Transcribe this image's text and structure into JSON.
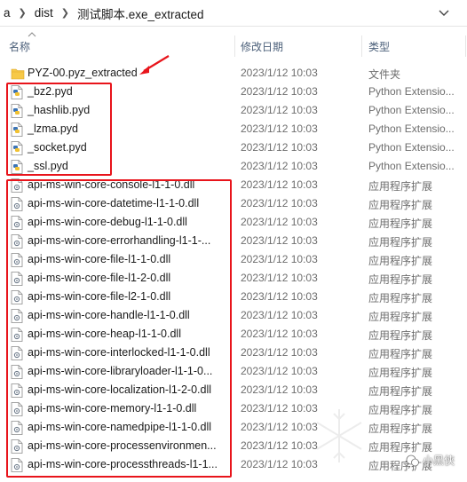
{
  "address": {
    "crumbs": [
      "a",
      "dist",
      "测试脚本.exe_extracted"
    ]
  },
  "columns": {
    "name": "名称",
    "date": "修改日期",
    "type": "类型"
  },
  "files": [
    {
      "name": "PYZ-00.pyz_extracted",
      "date": "2023/1/12 10:03",
      "type": "文件夹",
      "icon": "folder-icon"
    },
    {
      "name": "_bz2.pyd",
      "date": "2023/1/12 10:03",
      "type": "Python Extensio...",
      "icon": "python-file-icon"
    },
    {
      "name": "_hashlib.pyd",
      "date": "2023/1/12 10:03",
      "type": "Python Extensio...",
      "icon": "python-file-icon"
    },
    {
      "name": "_lzma.pyd",
      "date": "2023/1/12 10:03",
      "type": "Python Extensio...",
      "icon": "python-file-icon"
    },
    {
      "name": "_socket.pyd",
      "date": "2023/1/12 10:03",
      "type": "Python Extensio...",
      "icon": "python-file-icon"
    },
    {
      "name": "_ssl.pyd",
      "date": "2023/1/12 10:03",
      "type": "Python Extensio...",
      "icon": "python-file-icon"
    },
    {
      "name": "api-ms-win-core-console-l1-1-0.dll",
      "date": "2023/1/12 10:03",
      "type": "应用程序扩展",
      "icon": "dll-file-icon"
    },
    {
      "name": "api-ms-win-core-datetime-l1-1-0.dll",
      "date": "2023/1/12 10:03",
      "type": "应用程序扩展",
      "icon": "dll-file-icon"
    },
    {
      "name": "api-ms-win-core-debug-l1-1-0.dll",
      "date": "2023/1/12 10:03",
      "type": "应用程序扩展",
      "icon": "dll-file-icon"
    },
    {
      "name": "api-ms-win-core-errorhandling-l1-1-...",
      "date": "2023/1/12 10:03",
      "type": "应用程序扩展",
      "icon": "dll-file-icon"
    },
    {
      "name": "api-ms-win-core-file-l1-1-0.dll",
      "date": "2023/1/12 10:03",
      "type": "应用程序扩展",
      "icon": "dll-file-icon"
    },
    {
      "name": "api-ms-win-core-file-l1-2-0.dll",
      "date": "2023/1/12 10:03",
      "type": "应用程序扩展",
      "icon": "dll-file-icon"
    },
    {
      "name": "api-ms-win-core-file-l2-1-0.dll",
      "date": "2023/1/12 10:03",
      "type": "应用程序扩展",
      "icon": "dll-file-icon"
    },
    {
      "name": "api-ms-win-core-handle-l1-1-0.dll",
      "date": "2023/1/12 10:03",
      "type": "应用程序扩展",
      "icon": "dll-file-icon"
    },
    {
      "name": "api-ms-win-core-heap-l1-1-0.dll",
      "date": "2023/1/12 10:03",
      "type": "应用程序扩展",
      "icon": "dll-file-icon"
    },
    {
      "name": "api-ms-win-core-interlocked-l1-1-0.dll",
      "date": "2023/1/12 10:03",
      "type": "应用程序扩展",
      "icon": "dll-file-icon"
    },
    {
      "name": "api-ms-win-core-libraryloader-l1-1-0...",
      "date": "2023/1/12 10:03",
      "type": "应用程序扩展",
      "icon": "dll-file-icon"
    },
    {
      "name": "api-ms-win-core-localization-l1-2-0.dll",
      "date": "2023/1/12 10:03",
      "type": "应用程序扩展",
      "icon": "dll-file-icon"
    },
    {
      "name": "api-ms-win-core-memory-l1-1-0.dll",
      "date": "2023/1/12 10:03",
      "type": "应用程序扩展",
      "icon": "dll-file-icon"
    },
    {
      "name": "api-ms-win-core-namedpipe-l1-1-0.dll",
      "date": "2023/1/12 10:03",
      "type": "应用程序扩展",
      "icon": "dll-file-icon"
    },
    {
      "name": "api-ms-win-core-processenvironmen...",
      "date": "2023/1/12 10:03",
      "type": "应用程序扩展",
      "icon": "dll-file-icon"
    },
    {
      "name": "api-ms-win-core-processthreads-l1-1...",
      "date": "2023/1/12 10:03",
      "type": "应用程序扩展",
      "icon": "dll-file-icon"
    }
  ],
  "watermark": {
    "text": "小黑侠"
  },
  "colors": {
    "annotation": "#e8141b",
    "folder": "#f7c948",
    "header_text": "#4c607a",
    "secondary_text": "#6d6d6d"
  }
}
